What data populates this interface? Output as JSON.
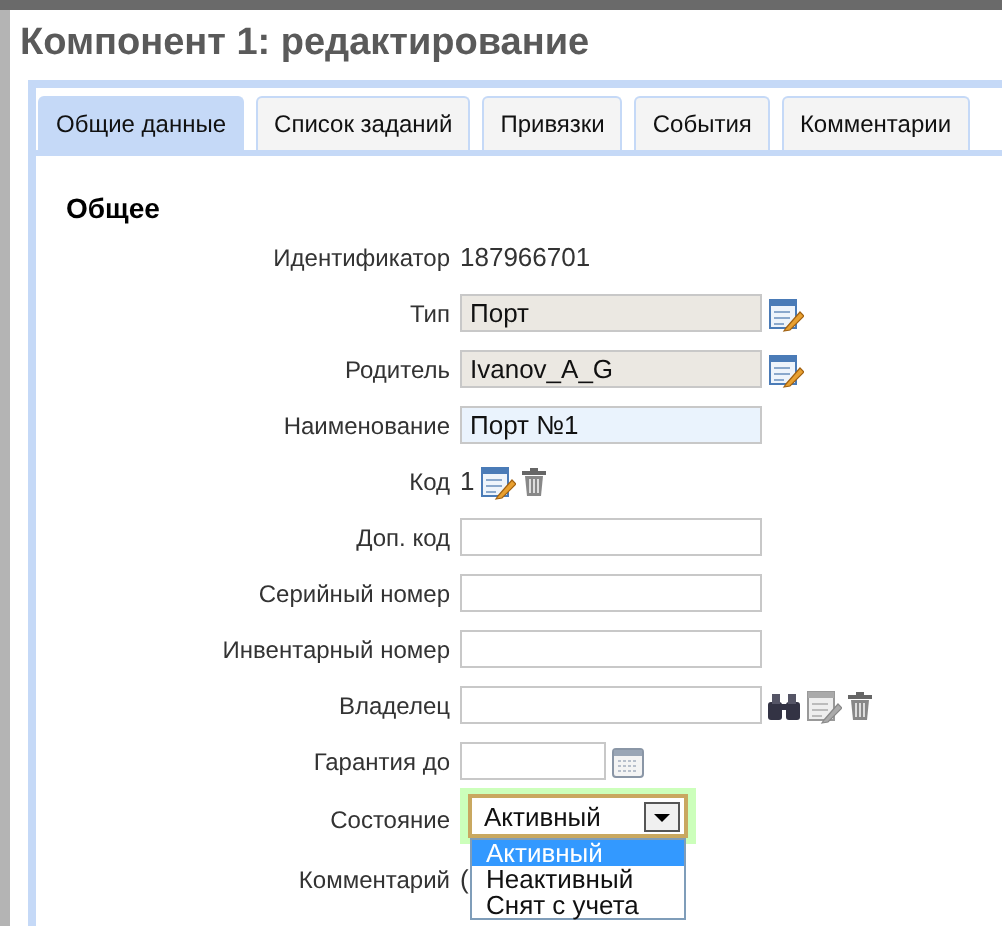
{
  "window": {
    "title": "Компонент 1: редактирование"
  },
  "tabs": [
    {
      "label": "Общие данные",
      "selected": true
    },
    {
      "label": "Список заданий",
      "selected": false
    },
    {
      "label": "Привязки",
      "selected": false
    },
    {
      "label": "События",
      "selected": false
    },
    {
      "label": "Комментарии",
      "selected": false
    }
  ],
  "section": {
    "title": "Общее"
  },
  "fields": [
    {
      "label": "Идентификатор",
      "kind": "text",
      "value": "187966701"
    },
    {
      "label": "Тип",
      "kind": "readonly",
      "value": "Порт",
      "icons": [
        {
          "kind": "edit",
          "disabled": false
        }
      ]
    },
    {
      "label": "Родитель",
      "kind": "readonly",
      "value": "Ivanov_A_G",
      "icons": [
        {
          "kind": "edit",
          "disabled": false
        }
      ]
    },
    {
      "label": "Наименование",
      "kind": "input",
      "value": "Порт №1",
      "focused": true
    },
    {
      "label": "Код",
      "kind": "text",
      "value": "1",
      "icons": [
        {
          "kind": "edit",
          "disabled": false
        },
        {
          "kind": "trash"
        }
      ]
    },
    {
      "label": "Доп. код",
      "kind": "input",
      "focused": false
    },
    {
      "label": "Серийный номер",
      "kind": "input",
      "focused": false
    },
    {
      "label": "Инвентарный номер",
      "kind": "input",
      "focused": false
    },
    {
      "label": "Владелец",
      "kind": "input",
      "focused": false,
      "icons": [
        {
          "kind": "search"
        },
        {
          "kind": "edit",
          "disabled": true
        },
        {
          "kind": "trash"
        }
      ]
    },
    {
      "label": "Гарантия до",
      "kind": "date",
      "focused": false,
      "icons": [
        {
          "kind": "calendar"
        }
      ]
    },
    {
      "label": "Состояние",
      "kind": "select",
      "value": "Активный",
      "open": true,
      "options": [
        {
          "label": "Активный",
          "selected": true
        },
        {
          "label": "Неактивный",
          "selected": false
        },
        {
          "label": "Снят с учета",
          "selected": false
        }
      ]
    },
    {
      "label": "Комментарий",
      "kind": "text",
      "value": "("
    }
  ]
}
